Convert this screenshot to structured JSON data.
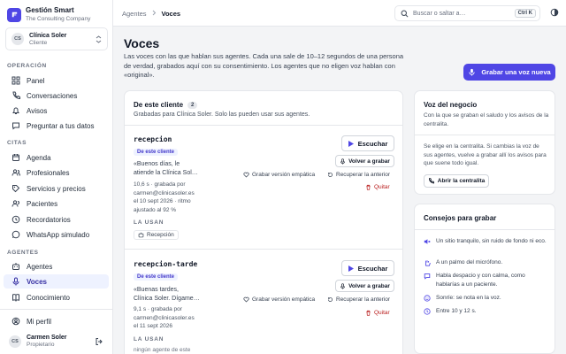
{
  "brand": {
    "name": "Gestión Smart",
    "tagline": "The Consulting Company"
  },
  "client": {
    "initials": "CS",
    "name": "Clínica Soler",
    "role": "Cliente"
  },
  "nav": {
    "sections": [
      {
        "label": "OPERACIÓN",
        "items": [
          "Panel",
          "Conversaciones",
          "Avisos",
          "Preguntar a tus datos"
        ]
      },
      {
        "label": "CITAS",
        "items": [
          "Agenda",
          "Profesionales",
          "Servicios y precios",
          "Pacientes",
          "Recordatorios",
          "WhatsApp simulado"
        ]
      },
      {
        "label": "AGENTES",
        "items": [
          "Agentes",
          "Voces",
          "Conocimiento"
        ]
      }
    ],
    "active": "Voces"
  },
  "footer": {
    "profile": "Mi perfil",
    "user_initials": "CS",
    "user_name": "Carmen Soler",
    "user_role": "Propietario"
  },
  "topbar": {
    "breadcrumb_parent": "Agentes",
    "breadcrumb_current": "Voces",
    "search_placeholder": "Buscar o saltar a…",
    "shortcut": "Ctrl K"
  },
  "page": {
    "title": "Voces",
    "description": "Las voces con las que hablan sus agentes. Cada una sale de 10–12 segundos de una persona de verdad, grabados aquí con su consentimiento. Los agentes que no eligen voz hablan con «original».",
    "record_button": "Grabar una voz nueva"
  },
  "client_voices": {
    "title": "De este cliente",
    "count": "2",
    "subtitle": "Grabadas para Clínica Soler. Solo las pueden usar sus agentes.",
    "tag": "De este cliente",
    "used_label": "LA USAN",
    "actions": {
      "listen": "Escuchar",
      "rerecord": "Volver a grabar",
      "empathic": "Grabar versión empática",
      "restore": "Recuperar la anterior",
      "remove": "Quitar"
    },
    "voices": [
      {
        "name": "recepcion",
        "quote_1": "«Buenos días, le",
        "quote_2": "atiende la Clínica Sol…",
        "meta_1": "10,6 s · grabada por",
        "meta_2": "carmen@clinicasoler.es",
        "meta_3": "el 10 sept 2026 · ritmo",
        "meta_4": "ajustado al 92 %",
        "used_by": "Recepción"
      },
      {
        "name": "recepcion-tarde",
        "quote_1": "«Buenas tardes,",
        "quote_2": "Clínica Soler. Dígame…",
        "meta_1": "9,1 s · grabada por",
        "meta_2": "carmen@clinicasoler.es",
        "meta_3": "el 11 sept 2026",
        "used_by_empty": "ningún agente de este"
      }
    ]
  },
  "business_voice": {
    "title": "Voz del negocio",
    "subtitle": "Con la que se graban el saludo y los avisos de la centralita.",
    "body": "Se elige en la centralita. Si cambias la voz de sus agentes, vuelve a grabar allí los avisos para que suene todo igual.",
    "button": "Abrir la centralita"
  },
  "tips": {
    "title": "Consejos para grabar",
    "items": [
      "Un sitio tranquilo, sin ruido de fondo ni eco.",
      "A un palmo del micrófono.",
      "Habla despacio y con calma, como hablarías a un paciente.",
      "Sonríe: se nota en la voz.",
      "Entre 10 y 12 s."
    ]
  },
  "colors": {
    "accent": "#4f46e5",
    "danger": "#b91c1c",
    "tip_icon": "#4f46e5"
  }
}
